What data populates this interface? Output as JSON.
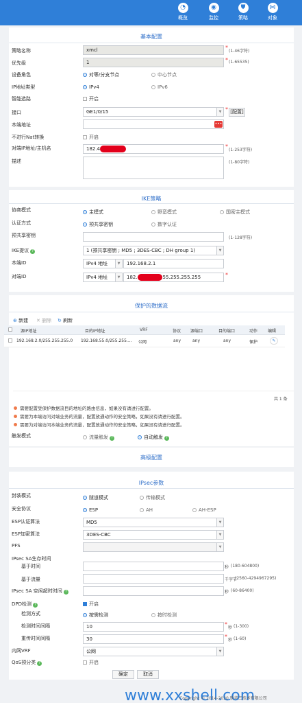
{
  "nav": [
    {
      "label": "概览",
      "icon": "dashboard-icon"
    },
    {
      "label": "监控",
      "icon": "monitor-icon"
    },
    {
      "label": "策略",
      "icon": "policy-icon"
    },
    {
      "label": "对象",
      "icon": "object-icon"
    }
  ],
  "basic": {
    "title": "基本配置",
    "policy_name_label": "策略名称",
    "policy_name": "xmcl",
    "policy_name_hint": "(1-46字符)",
    "priority_label": "优先级",
    "priority": "1",
    "priority_hint": "(1-65535)",
    "role_label": "设备角色",
    "role_opt1": "对等/分支节点",
    "role_opt2": "中心节点",
    "ip_type_label": "IP地址类型",
    "ip_opt1": "IPv4",
    "ip_opt2": "IPv6",
    "smart_label": "智能选路",
    "smart_chk": "开启",
    "iface_label": "接口",
    "iface": "GE1/0/15",
    "iface_btn": "[配置]",
    "local_label": "本端地址",
    "nat_label": "不进行Nat转换",
    "nat_chk": "开启",
    "peer_label": "对端IP地址/主机名",
    "peer_value": "182.45",
    "peer_hint": "(1-253字符)",
    "desc_label": "描述",
    "desc_hint": "(1-80字符)"
  },
  "ike": {
    "title": "IKE策略",
    "mode_label": "协商模式",
    "mode_opt1": "主模式",
    "mode_opt2": "野蛮模式",
    "mode_opt3": "国密主模式",
    "auth_label": "认证方式",
    "auth_opt1": "预共享密钥",
    "auth_opt2": "数字认证",
    "psk_label": "预共享密钥",
    "psk_hint": "(1-128字符)",
    "proposal_label": "IKE提议",
    "proposal": "1 (预共享密钥 ; MD5 ; 3DES-CBC ; DH group 1)",
    "local_id_label": "本端ID",
    "local_id_type": "IPv4 地址",
    "local_id": "192.168.2.1",
    "peer_id_label": "对端ID",
    "peer_id_type": "IPv4 地址",
    "peer_id_a": "182.4",
    "peer_id_b": "255.255.255.255"
  },
  "flow": {
    "title": "保护的数据流",
    "add": "新建",
    "delete": "删除",
    "refresh": "刷新",
    "headers": [
      "源IP地址",
      "目的IP地址",
      "VRF",
      "协议",
      "源端口",
      "目的端口",
      "动作",
      "编辑"
    ],
    "row": [
      "192.168.2.0/255.255.255.0",
      "192.168.55.0/255.255....",
      "公网",
      "any",
      "any",
      "any",
      "保护"
    ],
    "total": "共 1 条",
    "notes": [
      "需要配置受保护数据流目的地址的路由信息，如果没有请进行配置。",
      "需要为本端访问对端业务的流量，配置放通动作的安全策略，如果没有请进行配置。",
      "需要为对端访问本端业务的流量，配置放通动作的安全策略，如果没有请进行配置。"
    ],
    "trigger_label": "触发模式",
    "trigger_opt1": "流量触发",
    "trigger_opt2": "自动触发"
  },
  "advanced": {
    "title": "高级配置"
  },
  "ipsec": {
    "title": "IPsec参数",
    "encap_label": "封装模式",
    "encap_opt1": "隧道模式",
    "encap_opt2": "传输模式",
    "proto_label": "安全协议",
    "proto_opt1": "ESP",
    "proto_opt2": "AH",
    "proto_opt3": "AH-ESP",
    "esp_auth_label": "ESP认证算法",
    "esp_auth": "MD5",
    "esp_enc_label": "ESP加密算法",
    "esp_enc": "3DES-CBC",
    "pfs_label": "PFS",
    "lifetime_label": "IPsec SA生存时间",
    "time_label": "基于时间",
    "time_unit": "秒",
    "time_hint": "(180-604800)",
    "traffic_label": "基于流量",
    "traffic_unit": "千字节",
    "traffic_hint": "(2560-4294967295)",
    "idle_label": "IPsec SA 空闲超时时间",
    "idle_unit": "秒",
    "idle_hint": "(60-86400)",
    "dpd_label": "DPD检测",
    "dpd_chk": "开启",
    "detect_label": "检测方式",
    "detect_opt1": "按需检测",
    "detect_opt2": "按时检测",
    "interval_label": "检测时间间隔",
    "interval": "10",
    "interval_unit": "秒",
    "interval_hint": "(1-300)",
    "retry_label": "重传时间间隔",
    "retry": "30",
    "retry_unit": "秒",
    "retry_hint": "(1-60)",
    "vrf_label": "内网VRF",
    "vrf": "公网",
    "qos_label": "QoS预分类",
    "qos_chk": "开启"
  },
  "buttons": {
    "ok": "确定",
    "cancel": "取消"
  },
  "watermark": "www.xxshell.com",
  "copyright": "Copyright © 2014-2020 新华三技术有限公司"
}
